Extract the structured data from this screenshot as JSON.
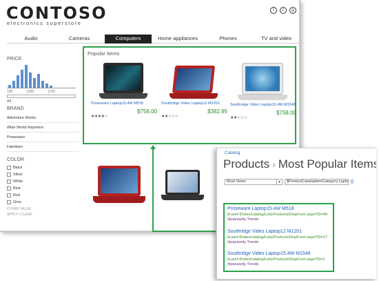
{
  "header": {
    "logo": "CONTOSO",
    "tagline": "electronics superstore",
    "social": [
      "f",
      "t",
      "g"
    ]
  },
  "nav": {
    "items": [
      "Audio",
      "Cameras",
      "Computers",
      "Home appliances",
      "Phones",
      "TV and video"
    ],
    "active_index": 2
  },
  "filters": {
    "price": {
      "title": "PRICE",
      "scale": [
        "100",
        "1000",
        "1750"
      ],
      "all_label": "All"
    },
    "brand": {
      "title": "BRAND",
      "items": [
        "Adventure Works",
        "Wide World Importers",
        "Proseware",
        "Fabrikam"
      ]
    },
    "color": {
      "title": "COLOR",
      "items": [
        "Black",
        "Silver",
        "White",
        "Blue",
        "Red",
        "Grey"
      ],
      "more": "OTHER VALUE",
      "apply": "APPLY / CLEAR"
    }
  },
  "popular": {
    "title": "Popular Items",
    "products": [
      {
        "name": "Proseware Laptop15.4W M518",
        "rating": "★★★★☆",
        "price": "$758.00"
      },
      {
        "name": "Southridge Video Laptop12 M1201",
        "rating": "★★☆☆☆",
        "price": "$382.95"
      },
      {
        "name": "Southridge Video Laptop15.4W M1548",
        "rating": "★★☆☆☆",
        "price": "$758.00"
      }
    ]
  },
  "catalog": {
    "breadcrumb": "Catalog",
    "title_part1": "Products",
    "title_sep": "›",
    "title_part2": "Most Popular Items",
    "sort_value": "Most Views",
    "search_value": "$ProductCatalogItemCategory:Laptops",
    "search_icon": "search-icon",
    "results": [
      {
        "title": "Proseware Laptop15.4W M518",
        "url": "ib-perf-8/sites/catalog/Lists/Products/DispForm.aspx?ID=48",
        "tag": "#popularity Trends"
      },
      {
        "title": "Southridge Video Laptop12 M1201",
        "url": "ib-perf-8/sites/catalog/Lists/Products/DispForm.aspx?ID=17",
        "tag": "#popularity Trends"
      },
      {
        "title": "Southridge Video Laptop15.4W M1548",
        "url": "ib-perf-8/sites/catalog/Lists/Products/DispForm.aspx?ID=1",
        "tag": "#popularity Trends"
      }
    ]
  },
  "colors": {
    "accent_green": "#2aa14b",
    "link_blue": "#1f5fb8",
    "price_green": "#2a8c2a"
  }
}
